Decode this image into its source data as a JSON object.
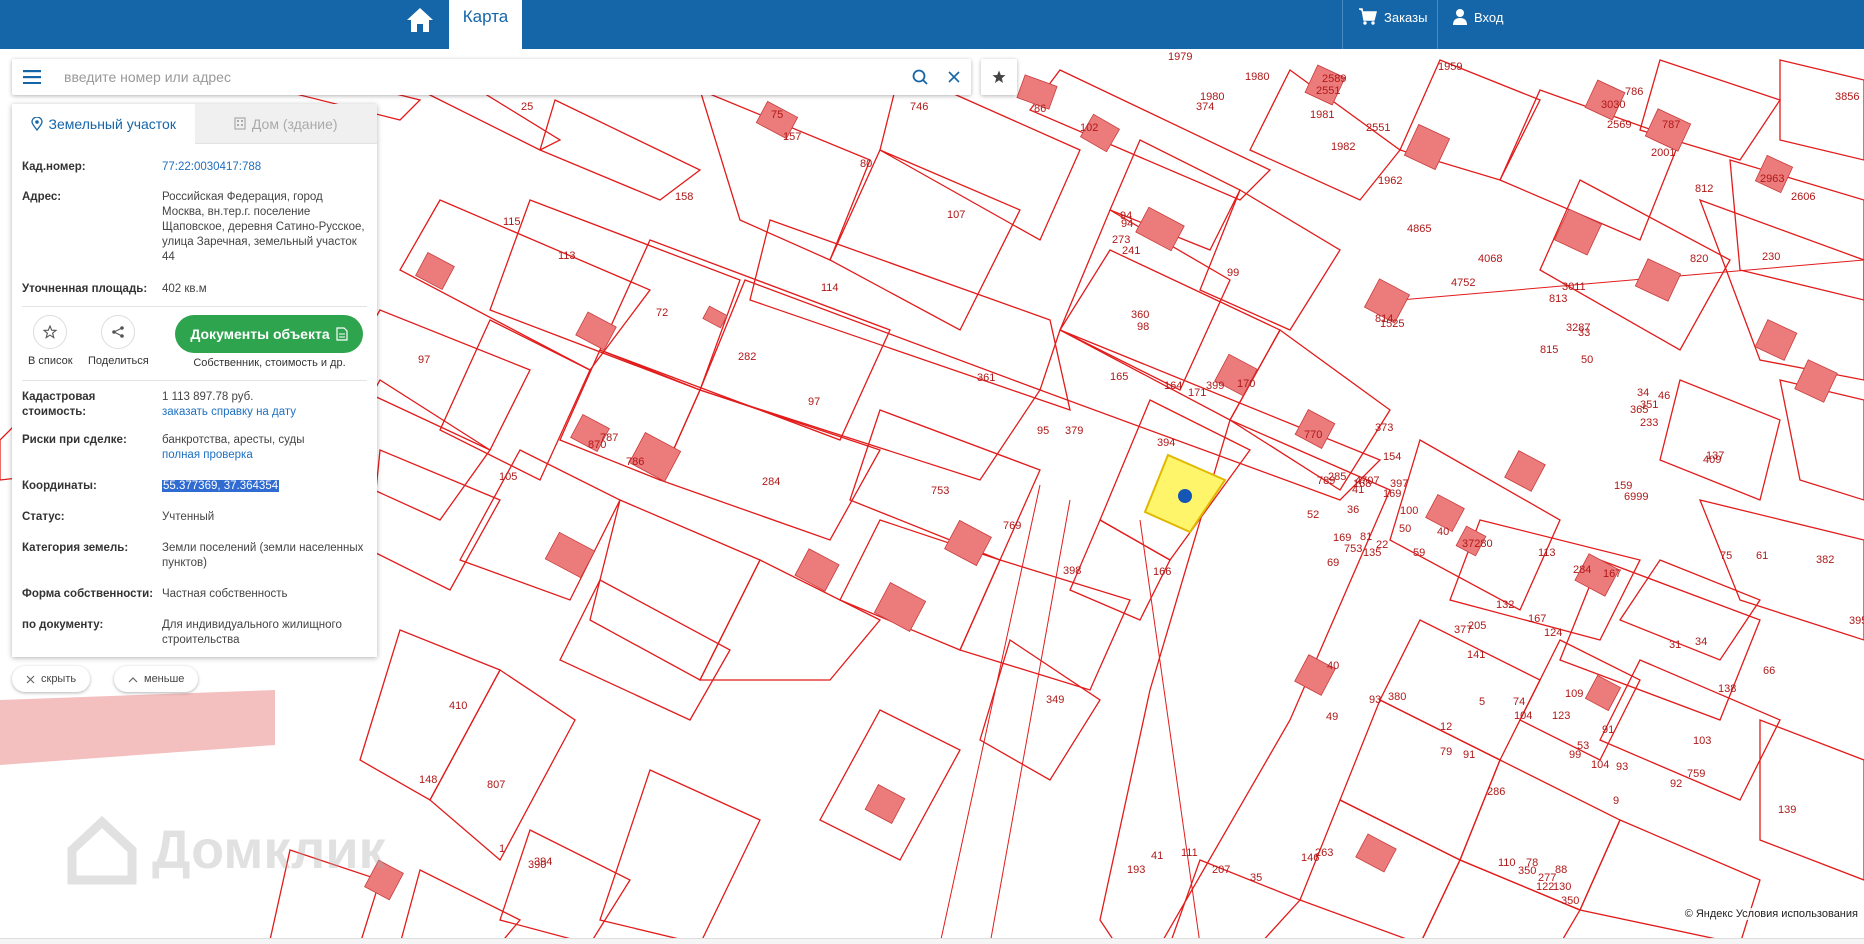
{
  "topbar": {
    "map_tab": "Карта",
    "orders_label": "Заказы",
    "login_label": "Вход"
  },
  "search": {
    "placeholder": "введите номер или адрес"
  },
  "panel": {
    "tab_land": "Земельный участок",
    "tab_building": "Дом (здание)",
    "cad_number_label": "Кад.номер:",
    "cad_number": "77:22:0030417:788",
    "address_label": "Адрес:",
    "address": "Российская Федерация, город Москва, вн.тер.г. поселение Щаповское, деревня Сатино-Русское, улица Заречная, земельный участок 44",
    "area_label": "Уточненная площадь:",
    "area": "402 кв.м",
    "action_list": "В список",
    "action_share": "Поделиться",
    "docs_button": "Документы объекта",
    "docs_sub": "Собственник, стоимость и др.",
    "cad_value_label": "Кадастровая стоимость:",
    "cad_value": "1 113 897.78 руб.",
    "cad_value_link": "заказать справку на дату",
    "risks_label": "Риски при сделке:",
    "risks": "банкротства, аресты, суды",
    "risks_link": "полная проверка",
    "coords_label": "Координаты:",
    "coords": "55.377369, 37.364354",
    "status_label": "Статус:",
    "status": "Учтенный",
    "category_label": "Категория земель:",
    "category": "Земли поселений (земли населенных пунктов)",
    "ownership_label": "Форма собственности:",
    "ownership": "Частная собственность",
    "by_doc_label": "по документу:",
    "by_doc": "Для индивидуального жилищного строительства"
  },
  "controls": {
    "hide": "скрыть",
    "less": "меньше"
  },
  "map": {
    "copyright": "© Яндекс Условия использования",
    "watermark": "Домклик",
    "labels": [
      "1979",
      "1980",
      "1959",
      "2589",
      "786",
      "3856",
      "25",
      "75",
      "157",
      "746",
      "86",
      "102",
      "374",
      "1980",
      "1981",
      "2551",
      "1982",
      "2551",
      "1962",
      "2569",
      "3030",
      "787",
      "2001",
      "812",
      "2963",
      "2606",
      "158",
      "80",
      "107",
      "115",
      "113",
      "94",
      "273",
      "94",
      "241",
      "99",
      "4865",
      "4752",
      "4068",
      "813",
      "3011",
      "820",
      "230",
      "114",
      "72",
      "98",
      "360",
      "814",
      "1525",
      "815",
      "3287",
      "33",
      "50",
      "34",
      "46",
      "233",
      "97",
      "282",
      "97",
      "361",
      "164",
      "399",
      "171",
      "170",
      "373",
      "154",
      "365",
      "351",
      "409",
      "137",
      "870",
      "786",
      "787",
      "95",
      "379",
      "165",
      "394",
      "168",
      "789",
      "285",
      "169",
      "41",
      "36",
      "159",
      "6999",
      "105",
      "284",
      "753",
      "166",
      "769",
      "398",
      "770",
      "4707",
      "397",
      "100",
      "52",
      "69",
      "169",
      "81",
      "753",
      "135",
      "37280",
      "22",
      "50",
      "40",
      "59",
      "284",
      "167",
      "75",
      "61",
      "382",
      "395",
      "40",
      "380",
      "132",
      "141",
      "205",
      "167",
      "113",
      "124",
      "31",
      "34",
      "66",
      "138",
      "103",
      "148",
      "349",
      "49",
      "93",
      "377",
      "74",
      "123",
      "109",
      "12",
      "79",
      "91",
      "286",
      "104",
      "5",
      "53",
      "99",
      "91",
      "104",
      "9",
      "93",
      "759",
      "92",
      "139",
      "410",
      "807",
      "1",
      "390",
      "394",
      "41",
      "193",
      "111",
      "207",
      "35",
      "263",
      "146",
      "277",
      "122",
      "110",
      "78",
      "88",
      "130",
      "350",
      "350"
    ]
  }
}
